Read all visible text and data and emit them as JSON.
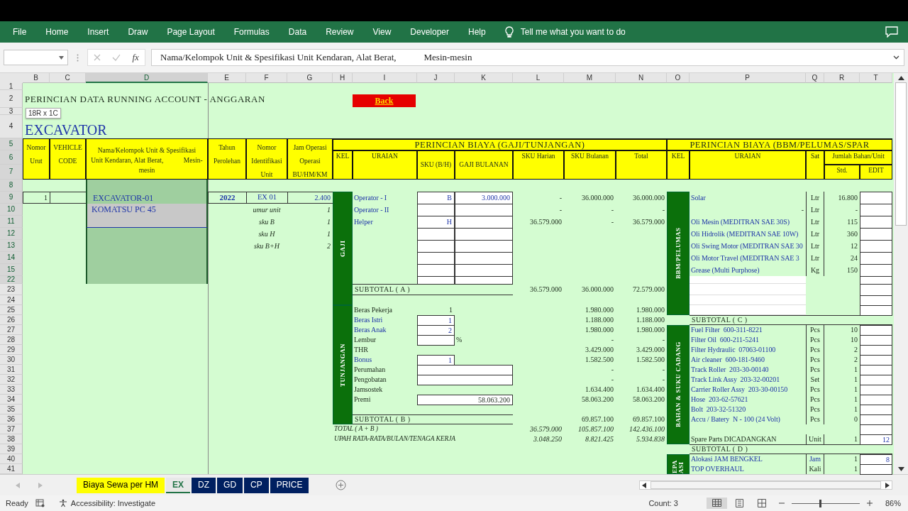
{
  "ribbon": {
    "tabs": [
      "File",
      "Home",
      "Insert",
      "Draw",
      "Page Layout",
      "Formulas",
      "Data",
      "Review",
      "View",
      "Developer",
      "Help"
    ],
    "tell_me": "Tell me what you want to do"
  },
  "formula_bar": {
    "fx": "fx",
    "formula": "Nama/Kelompok Unit & Spesifikasi Unit Kendaran, Alat Berat,            Mesin-mesin"
  },
  "selection_tip": "18R x 1C",
  "columns": [
    {
      "letter": "B",
      "selected": false
    },
    {
      "letter": "C",
      "selected": false
    },
    {
      "letter": "D",
      "selected": true
    },
    {
      "letter": "E",
      "selected": false
    },
    {
      "letter": "F",
      "selected": false
    },
    {
      "letter": "G",
      "selected": false
    },
    {
      "letter": "H",
      "selected": false
    },
    {
      "letter": "I",
      "selected": false
    },
    {
      "letter": "J",
      "selected": false
    },
    {
      "letter": "K",
      "selected": false
    },
    {
      "letter": "L",
      "selected": false
    },
    {
      "letter": "M",
      "selected": false
    },
    {
      "letter": "N",
      "selected": false
    },
    {
      "letter": "O",
      "selected": false
    },
    {
      "letter": "P",
      "selected": false
    },
    {
      "letter": "Q",
      "selected": false
    },
    {
      "letter": "R",
      "selected": false
    },
    {
      "letter": "T",
      "selected": false
    }
  ],
  "rows": [
    {
      "label": "1",
      "selected": false
    },
    {
      "label": "2",
      "selected": false,
      "cells": {
        "B": {
          "kind": "title",
          "text": "PERINCIAN DATA RUNNING ACCOUNT - ANGGARAN"
        },
        "I": {
          "kind": "link",
          "text": "Back"
        }
      }
    },
    {
      "label": "3",
      "selected": false
    },
    {
      "label": "4",
      "selected": false,
      "cells": {
        "B": {
          "kind": "heading",
          "text": "EXCAVATOR"
        }
      }
    },
    {
      "label": "5",
      "selected": true,
      "cells": {
        "B": {
          "kind": "head",
          "lines": [
            "Nomor",
            "Urut"
          ]
        },
        "C": {
          "kind": "head",
          "lines": [
            "VEHICLE",
            "CODE"
          ]
        },
        "D": {
          "kind": "head-wrap",
          "lines": [
            "Nama/Kelompok Unit & Spesifikasi",
            "Unit Kendaran, Alat Berat,            Mesin-",
            "mesin"
          ]
        },
        "E": {
          "kind": "head",
          "lines": [
            "Tahun",
            "Perolehan"
          ]
        },
        "F": {
          "kind": "head",
          "lines": [
            "Nomor",
            "Identifikasi",
            "Unit"
          ]
        },
        "G": {
          "kind": "head",
          "lines": [
            "Jam Operasi",
            "Operasi",
            "BU/HM/KM"
          ]
        },
        "H": {
          "kind": "head-big",
          "text": "PERINCIAN BIAYA (GAJI/TUNJANGAN)"
        },
        "O": {
          "kind": "head-big",
          "text": "PERINCIAN BIAYA (BBM/PELUMAS/SPAR"
        }
      }
    },
    {
      "label": "6",
      "selected": true,
      "cells": {
        "H": {
          "kind": "head",
          "text": "KEL"
        },
        "I": {
          "kind": "head",
          "text": "URAIAN"
        },
        "J": {
          "kind": "head-mid",
          "text": "SKU (B/H)"
        },
        "K": {
          "kind": "head-mid",
          "text": "GAJI BULANAN"
        },
        "L": {
          "kind": "head",
          "text": "SKU Harian"
        },
        "M": {
          "kind": "head",
          "text": "SKU Bulanan"
        },
        "N": {
          "kind": "head",
          "text": "Total"
        },
        "O": {
          "kind": "head",
          "text": "KEL"
        },
        "P": {
          "kind": "head",
          "text": "URAIAN"
        },
        "Q": {
          "kind": "head",
          "text": "Sat"
        },
        "R": {
          "kind": "head",
          "text": "Jumlah Bahan/Unit"
        }
      }
    },
    {
      "label": "7",
      "selected": true,
      "cells": {
        "R": {
          "kind": "head",
          "text": "Std."
        },
        "T": {
          "kind": "head",
          "text": "EDIT"
        }
      }
    },
    {
      "label": "8",
      "selected": true,
      "cells": {
        "D": {
          "kind": "sel"
        }
      }
    },
    {
      "label": "9",
      "selected": true,
      "cells": {
        "B": {
          "kind": "box-num",
          "text": "1"
        },
        "C": {
          "kind": "box"
        },
        "D": {
          "kind": "sel-name",
          "text": "EXCAVATOR-01"
        },
        "E": {
          "kind": "box-bold",
          "text": "2022"
        },
        "F": {
          "kind": "box-center",
          "text": "EX 01"
        },
        "G": {
          "kind": "box-num-blue",
          "text": "2.400"
        },
        "H": {
          "kind": "band",
          "text": "GAJI"
        },
        "I": {
          "kind": "text-blue",
          "text": "Operator - I"
        },
        "J": {
          "kind": "input-center",
          "text": "B"
        },
        "K": {
          "kind": "input",
          "text": "3.000.000"
        },
        "L": {
          "kind": "num",
          "text": "-"
        },
        "M": {
          "kind": "num",
          "text": "36.000.000"
        },
        "N": {
          "kind": "num",
          "text": "36.000.000"
        },
        "O": {
          "kind": "band",
          "text": "BBM/PELUMAS"
        },
        "P": {
          "kind": "text-blue",
          "text": "Solar"
        },
        "Q": {
          "kind": "unit",
          "text": "Ltr"
        },
        "R": {
          "kind": "num",
          "text": "16.800"
        },
        "T": {
          "kind": "input"
        }
      }
    },
    {
      "label": "10",
      "selected": true,
      "cells": {
        "D": {
          "kind": "grey",
          "text": "KOMATSU PC 45"
        },
        "F": {
          "kind": "italic",
          "text": "umur unit"
        },
        "G": {
          "kind": "italic-num",
          "text": "1"
        },
        "I": {
          "kind": "text-blue",
          "text": "Operator - II"
        },
        "J": {
          "kind": "input"
        },
        "K": {
          "kind": "input"
        },
        "L": {
          "kind": "num",
          "text": "-"
        },
        "M": {
          "kind": "num",
          "text": "-"
        },
        "N": {
          "kind": "num",
          "text": "-"
        },
        "P": {
          "kind": "num",
          "text": "-"
        },
        "Q": {
          "kind": "unit",
          "text": "Ltr"
        },
        "R": {
          "kind": "num",
          "text": "-"
        },
        "T": {
          "kind": "input"
        }
      }
    },
    {
      "label": "11",
      "selected": true,
      "cells": {
        "F": {
          "kind": "italic",
          "text": "sku B"
        },
        "G": {
          "kind": "italic-num",
          "text": "1"
        },
        "I": {
          "kind": "text-blue",
          "text": "Helper"
        },
        "J": {
          "kind": "input-center",
          "text": "H"
        },
        "K": {
          "kind": "input"
        },
        "L": {
          "kind": "num",
          "text": "36.579.000"
        },
        "M": {
          "kind": "num",
          "text": "-"
        },
        "N": {
          "kind": "num",
          "text": "36.579.000"
        },
        "P": {
          "kind": "text-blue",
          "text": "Oli Mesin (MEDITRAN SAE 30S)"
        },
        "Q": {
          "kind": "unit",
          "text": "Ltr"
        },
        "R": {
          "kind": "num",
          "text": "115"
        },
        "T": {
          "kind": "input"
        }
      }
    },
    {
      "label": "12",
      "selected": true,
      "cells": {
        "D": {
          "kind": "sel"
        },
        "F": {
          "kind": "italic",
          "text": "sku H"
        },
        "G": {
          "kind": "italic-num",
          "text": "1"
        },
        "J": {
          "kind": "input"
        },
        "K": {
          "kind": "input"
        },
        "P": {
          "kind": "text-blue",
          "text": "Oli Hidrolik (MEDITRAN SAE 10W)"
        },
        "Q": {
          "kind": "unit",
          "text": "Ltr"
        },
        "R": {
          "kind": "num",
          "text": "360"
        },
        "T": {
          "kind": "input"
        }
      }
    },
    {
      "label": "13",
      "selected": true,
      "cells": {
        "F": {
          "kind": "italic",
          "text": "sku B+H"
        },
        "G": {
          "kind": "italic-num",
          "text": "2"
        },
        "J": {
          "kind": "input"
        },
        "K": {
          "kind": "input"
        },
        "P": {
          "kind": "text-blue",
          "text": "Oli Swing Motor (MEDITRAN SAE 30"
        },
        "Q": {
          "kind": "unit",
          "text": "Ltr"
        },
        "R": {
          "kind": "num",
          "text": "12"
        },
        "T": {
          "kind": "input"
        }
      }
    },
    {
      "label": "14",
      "selected": true,
      "cells": {
        "J": {
          "kind": "input"
        },
        "K": {
          "kind": "input"
        },
        "P": {
          "kind": "text-blue",
          "text": "Oli Motor Travel (MEDITRAN SAE 3"
        },
        "Q": {
          "kind": "unit",
          "text": "Ltr"
        },
        "R": {
          "kind": "num",
          "text": "24"
        },
        "T": {
          "kind": "input"
        }
      }
    },
    {
      "label": "15",
      "selected": true,
      "cells": {
        "J": {
          "kind": "input"
        },
        "K": {
          "kind": "input"
        },
        "P": {
          "kind": "text-blue",
          "text": "Grease (Multi Purphose)"
        },
        "Q": {
          "kind": "unit",
          "text": "Kg"
        },
        "R": {
          "kind": "num",
          "text": "150"
        },
        "T": {
          "kind": "input"
        }
      }
    },
    {
      "label": "22",
      "selected": true,
      "cells": {
        "J": {
          "kind": "input"
        },
        "K": {
          "kind": "input"
        },
        "P": {
          "kind": "white"
        },
        "T": {
          "kind": "input"
        }
      }
    },
    {
      "label": "23",
      "selected": false,
      "cells": {
        "I": {
          "kind": "subtotal",
          "text": "SUBTOTAL ( A )"
        },
        "L": {
          "kind": "num",
          "text": "36.579.000"
        },
        "M": {
          "kind": "num",
          "text": "36.000.000"
        },
        "N": {
          "kind": "num",
          "text": "72.579.000"
        },
        "P": {
          "kind": "white"
        },
        "T": {
          "kind": "input"
        }
      }
    },
    {
      "label": "24",
      "selected": false,
      "cells": {
        "P": {
          "kind": "white"
        },
        "T": {
          "kind": "input"
        }
      }
    },
    {
      "label": "25",
      "selected": false,
      "cells": {
        "H": {
          "kind": "band",
          "text": "TUNJANGAN"
        },
        "I": {
          "kind": "text",
          "text": "Beras Pekerja"
        },
        "J": {
          "kind": "num",
          "text": "1"
        },
        "M": {
          "kind": "num",
          "text": "1.980.000"
        },
        "N": {
          "kind": "num",
          "text": "1.980.000"
        },
        "P": {
          "kind": "white"
        },
        "T": {
          "kind": "input"
        }
      }
    },
    {
      "label": "26",
      "selected": false,
      "cells": {
        "I": {
          "kind": "text-blue",
          "text": "Beras Istri"
        },
        "J": {
          "kind": "input",
          "text": "1"
        },
        "M": {
          "kind": "num",
          "text": "1.188.000"
        },
        "N": {
          "kind": "num",
          "text": "1.188.000"
        },
        "P": {
          "kind": "subtotal",
          "text": "SUBTOTAL ( C )"
        }
      }
    },
    {
      "label": "27",
      "selected": false,
      "cells": {
        "I": {
          "kind": "text-blue",
          "text": "Beras Anak"
        },
        "J": {
          "kind": "input",
          "text": "2"
        },
        "M": {
          "kind": "num",
          "text": "1.980.000"
        },
        "N": {
          "kind": "num",
          "text": "1.980.000"
        },
        "O": {
          "kind": "band",
          "text": "BAHAN & SUKU CADANG"
        },
        "P": {
          "kind": "text-blue",
          "text": "Fuel Filter  600-311-8221"
        },
        "Q": {
          "kind": "unit",
          "text": "Pcs"
        },
        "R": {
          "kind": "num",
          "text": "10"
        },
        "T": {
          "kind": "input"
        }
      }
    },
    {
      "label": "28",
      "selected": false,
      "cells": {
        "I": {
          "kind": "text",
          "text": "Lembur"
        },
        "J": {
          "kind": "input"
        },
        "K": {
          "kind": "text",
          "text": "%"
        },
        "M": {
          "kind": "num",
          "text": "-"
        },
        "N": {
          "kind": "num",
          "text": "-"
        },
        "P": {
          "kind": "text-blue",
          "text": "Filter Oil  600-211-5241"
        },
        "Q": {
          "kind": "unit",
          "text": "Pcs"
        },
        "R": {
          "kind": "num",
          "text": "10"
        },
        "T": {
          "kind": "input"
        }
      }
    },
    {
      "label": "29",
      "selected": false,
      "cells": {
        "I": {
          "kind": "text",
          "text": "THR"
        },
        "M": {
          "kind": "num",
          "text": "3.429.000"
        },
        "N": {
          "kind": "num",
          "text": "3.429.000"
        },
        "P": {
          "kind": "text-blue",
          "text": "Filter Hydraulic  07063-01100"
        },
        "Q": {
          "kind": "unit",
          "text": "Pcs"
        },
        "R": {
          "kind": "num",
          "text": "2"
        },
        "T": {
          "kind": "input"
        }
      }
    },
    {
      "label": "30",
      "selected": false,
      "cells": {
        "I": {
          "kind": "text-blue",
          "text": "Bonus"
        },
        "J": {
          "kind": "input",
          "text": "1"
        },
        "M": {
          "kind": "num",
          "text": "1.582.500"
        },
        "N": {
          "kind": "num",
          "text": "1.582.500"
        },
        "P": {
          "kind": "text-blue",
          "text": "Air cleaner  600-181-9460"
        },
        "Q": {
          "kind": "unit",
          "text": "Pcs"
        },
        "R": {
          "kind": "num",
          "text": "2"
        },
        "T": {
          "kind": "input"
        }
      }
    },
    {
      "label": "31",
      "selected": false,
      "cells": {
        "I": {
          "kind": "text",
          "text": "Perumahan"
        },
        "J": {
          "kind": "input"
        },
        "M": {
          "kind": "num",
          "text": "-"
        },
        "N": {
          "kind": "num",
          "text": "-"
        },
        "P": {
          "kind": "text-blue",
          "text": "Track Roller  203-30-00140"
        },
        "Q": {
          "kind": "unit",
          "text": "Pcs"
        },
        "R": {
          "kind": "num",
          "text": "1"
        },
        "T": {
          "kind": "input"
        }
      }
    },
    {
      "label": "32",
      "selected": false,
      "cells": {
        "I": {
          "kind": "text",
          "text": "Pengobatan"
        },
        "J": {
          "kind": "input"
        },
        "M": {
          "kind": "num",
          "text": "-"
        },
        "N": {
          "kind": "num",
          "text": "-"
        },
        "P": {
          "kind": "text-blue",
          "text": "Track Link Assy  203-32-00201"
        },
        "Q": {
          "kind": "unit",
          "text": "Set"
        },
        "R": {
          "kind": "num",
          "text": "1"
        },
        "T": {
          "kind": "input"
        }
      }
    },
    {
      "label": "33",
      "selected": false,
      "cells": {
        "I": {
          "kind": "text",
          "text": "Jamsostek"
        },
        "M": {
          "kind": "num",
          "text": "1.634.400"
        },
        "N": {
          "kind": "num",
          "text": "1.634.400"
        },
        "P": {
          "kind": "text-blue",
          "text": "Carrier Roller Assy  203-30-00150"
        },
        "Q": {
          "kind": "unit",
          "text": "Pcs"
        },
        "R": {
          "kind": "num",
          "text": "1"
        },
        "T": {
          "kind": "input"
        }
      }
    },
    {
      "label": "34",
      "selected": false,
      "cells": {
        "I": {
          "kind": "text",
          "text": "Premi"
        },
        "J": {
          "kind": "input-dark",
          "text": "58.063.200"
        },
        "M": {
          "kind": "num",
          "text": "58.063.200"
        },
        "N": {
          "kind": "num",
          "text": "58.063.200"
        },
        "P": {
          "kind": "text-blue",
          "text": "Hose  203-62-57621"
        },
        "Q": {
          "kind": "unit",
          "text": "Pcs"
        },
        "R": {
          "kind": "num",
          "text": "1"
        },
        "T": {
          "kind": "input"
        }
      }
    },
    {
      "label": "35",
      "selected": false,
      "cells": {
        "P": {
          "kind": "text-blue",
          "text": "Bolt  203-32-51320"
        },
        "Q": {
          "kind": "unit",
          "text": "Pcs"
        },
        "R": {
          "kind": "num",
          "text": "1"
        },
        "T": {
          "kind": "input"
        }
      }
    },
    {
      "label": "36",
      "selected": false,
      "cells": {
        "I": {
          "kind": "subtotal",
          "text": "SUBTOTAL ( B )"
        },
        "M": {
          "kind": "num",
          "text": "69.857.100"
        },
        "N": {
          "kind": "num",
          "text": "69.857.100"
        },
        "P": {
          "kind": "text-blue",
          "text": "Accu / Batery  N - 100 (24 Volt)"
        },
        "Q": {
          "kind": "unit",
          "text": "Pcs"
        },
        "R": {
          "kind": "num",
          "text": "0"
        },
        "T": {
          "kind": "input"
        }
      }
    },
    {
      "label": "37",
      "selected": false,
      "cells": {
        "H": {
          "kind": "italic-text",
          "text": "TOTAL ( A + B )"
        },
        "L": {
          "kind": "italic-num",
          "text": "36.579.000"
        },
        "M": {
          "kind": "italic-num",
          "text": "105.857.100"
        },
        "N": {
          "kind": "italic-num",
          "text": "142.436.100"
        },
        "T": {
          "kind": "input"
        }
      }
    },
    {
      "label": "38",
      "selected": false,
      "cells": {
        "H": {
          "kind": "italic-text",
          "text": "UPAH RATA-RATA/BULAN/TENAGA KERJA"
        },
        "L": {
          "kind": "italic-num",
          "text": "3.048.250"
        },
        "M": {
          "kind": "italic-num",
          "text": "8.821.425"
        },
        "N": {
          "kind": "italic-num",
          "text": "5.934.838"
        },
        "P": {
          "kind": "text",
          "text": "Spare Parts DICADANGKAN"
        },
        "Q": {
          "kind": "unit",
          "text": "Unit"
        },
        "R": {
          "kind": "num",
          "text": "1"
        },
        "T": {
          "kind": "input",
          "text": "12"
        }
      }
    },
    {
      "label": "39",
      "selected": false,
      "cells": {
        "P": {
          "kind": "subtotal",
          "text": "SUBTOTAL ( D )"
        }
      }
    },
    {
      "label": "40",
      "selected": false,
      "cells": {
        "O": {
          "kind": "band",
          "text": "EPA ASI"
        },
        "P": {
          "kind": "text-blue",
          "text": "Alokasi JAM BENGKEL"
        },
        "Q": {
          "kind": "unit-blue",
          "text": "Jam"
        },
        "R": {
          "kind": "num",
          "text": "1"
        },
        "T": {
          "kind": "input",
          "text": "8"
        }
      }
    },
    {
      "label": "41",
      "selected": false,
      "cells": {
        "P": {
          "kind": "text-blue",
          "text": "TOP OVERHAUL"
        },
        "Q": {
          "kind": "unit",
          "text": "Kali"
        },
        "R": {
          "kind": "num",
          "text": "1"
        },
        "T": {
          "kind": "input"
        }
      }
    }
  ],
  "sheet_tabs": [
    {
      "label": "Biaya Sewa per HM",
      "selected": false,
      "color": "#ffff00"
    },
    {
      "label": "EX",
      "selected": true
    },
    {
      "label": "DZ",
      "selected": false,
      "color": "#002060"
    },
    {
      "label": "GD",
      "selected": false,
      "color": "#002060"
    },
    {
      "label": "CP",
      "selected": false,
      "color": "#002060"
    },
    {
      "label": "PRICE",
      "selected": false,
      "color": "#002060"
    }
  ],
  "status_bar": {
    "ready": "Ready",
    "accessibility": "Accessibility: Investigate",
    "count": "Count: 3",
    "views": [
      {
        "selected": true
      },
      {
        "selected": false
      },
      {
        "selected": false
      }
    ],
    "zoom": {
      "level": 0.42,
      "reading": "86%"
    }
  }
}
